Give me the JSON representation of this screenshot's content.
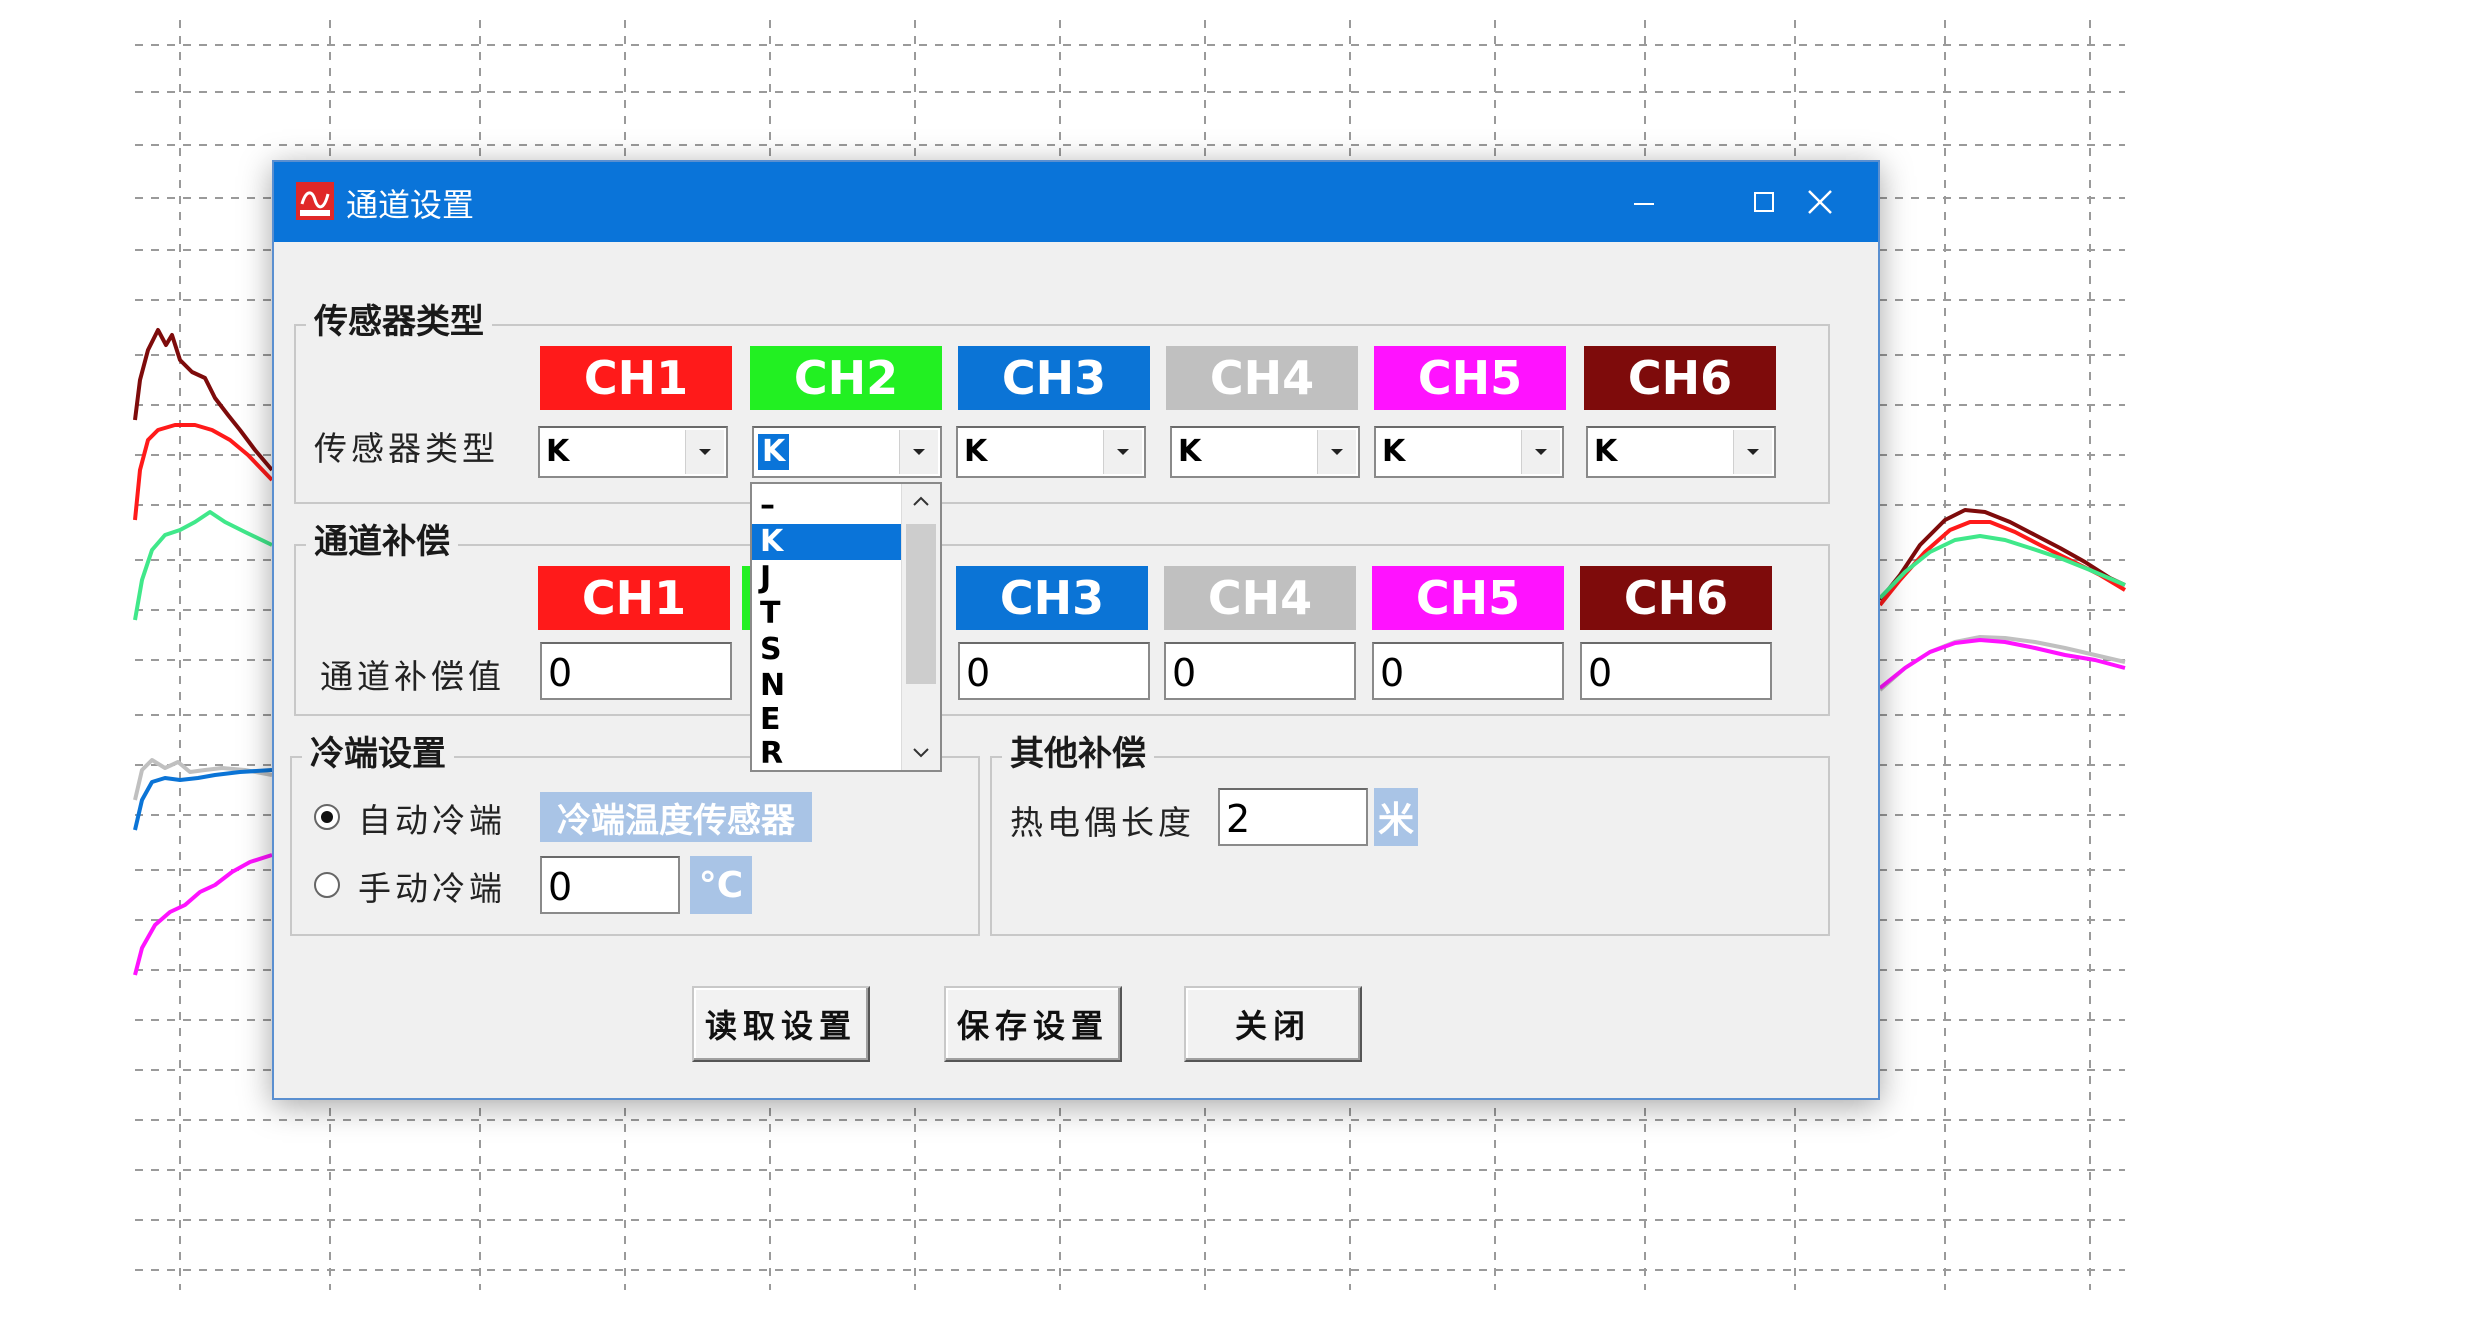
{
  "window": {
    "title": "通道设置"
  },
  "colors": {
    "ch1": "#ff1a1a",
    "ch2": "#22f022",
    "ch3": "#0b74d6",
    "ch4": "#c0c0c0",
    "ch5": "#ff12ff",
    "ch6": "#7e0b0b",
    "titlebar": "#0a74d9",
    "tag": "#a9c4e6"
  },
  "sensor_group": {
    "title": "传感器类型",
    "row_label": "传感器类型",
    "channels": [
      "CH1",
      "CH2",
      "CH3",
      "CH4",
      "CH5",
      "CH6"
    ],
    "values": [
      "K",
      "K",
      "K",
      "K",
      "K",
      "K"
    ]
  },
  "dropdown": {
    "options": [
      "–",
      "K",
      "J",
      "T",
      "S",
      "N",
      "E",
      "R"
    ],
    "selected": "K"
  },
  "comp_group": {
    "title": "通道补偿",
    "row_label": "通道补偿值",
    "channels": [
      "CH1",
      "CH3",
      "CH4",
      "CH5",
      "CH6"
    ],
    "values": [
      "0",
      "0",
      "0",
      "0",
      "0"
    ]
  },
  "cold_group": {
    "title": "冷端设置",
    "auto_label": "自动冷端",
    "auto_sensor": "冷端温度传感器",
    "manual_label": "手动冷端",
    "manual_value": "0",
    "unit": "°C"
  },
  "other_group": {
    "title": "其他补偿",
    "length_label": "热电偶长度",
    "length_value": "2",
    "unit": "米"
  },
  "buttons": {
    "read": "读取设置",
    "save": "保存设置",
    "close": "关闭"
  },
  "icons": {
    "app": "app-logo-icon",
    "minimize": "minimize-icon",
    "maximize": "maximize-icon",
    "close": "close-icon"
  }
}
